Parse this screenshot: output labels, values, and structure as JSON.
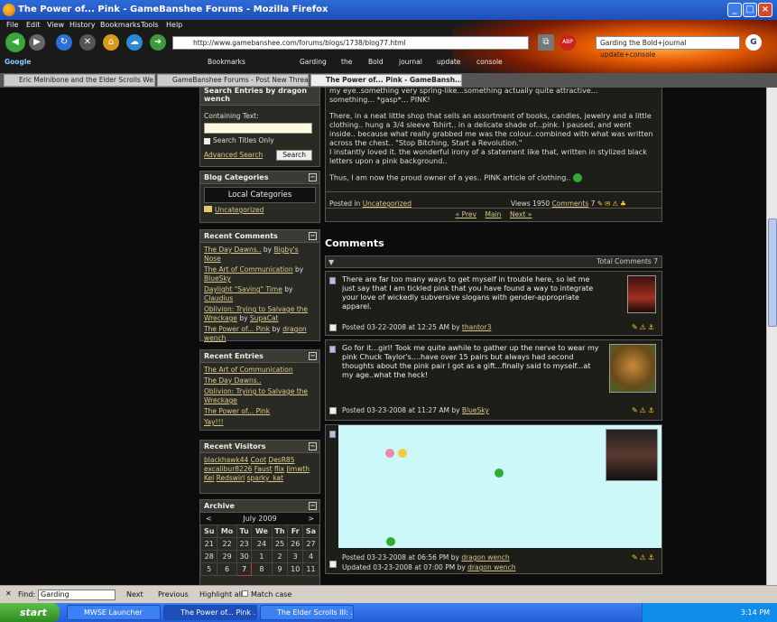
{
  "window": {
    "title": "The Power of... Pink - GameBanshee Forums - Mozilla Firefox"
  },
  "menu": [
    "File",
    "Edit",
    "View",
    "History",
    "Bookmarks",
    "Tools",
    "Help"
  ],
  "url": "http://www.gamebanshee.com/forums/blogs/1738/blog77.html",
  "search_value": "Garding the Bold+journal update+console",
  "bookmarks": [
    "Google",
    "Bookmarks",
    "Garding",
    "the",
    "Bold",
    "journal",
    "update",
    "console"
  ],
  "tabs": [
    "Eric Melnibone and the Elder Scrolls We...",
    "GameBanshee Forums - Post New Thread",
    "The Power of... Pink - GameBansh..."
  ],
  "sidebar": {
    "search": {
      "title": "Search Entries by dragon wench",
      "label": "Containing Text:",
      "titles_only": "Search Titles Only",
      "advanced": "Advanced Search",
      "button": "Search"
    },
    "categories": {
      "title": "Blog Categories",
      "local": "Local Categories",
      "item": "Uncategorized"
    },
    "recent_comments": {
      "title": "Recent Comments",
      "items": [
        {
          "t": "The Day Dawns..",
          "by": "by",
          "u": "Bigby's Nose"
        },
        {
          "t": "The Art of Communication",
          "by": "by",
          "u": "BlueSky"
        },
        {
          "t": "Daylight \"Saving\" Time",
          "by": "by",
          "u": "Claudius"
        },
        {
          "t": "Oblivion: Trying to Salvage the Wreckage",
          "by": "by",
          "u": "SupaCat"
        },
        {
          "t": "The Power of... Pink",
          "by": "by",
          "u": "dragon wench"
        }
      ]
    },
    "recent_entries": {
      "title": "Recent Entries",
      "items": [
        "The Art of Communication",
        "The Day Dawns..",
        "Oblivion: Trying to Salvage the Wreckage",
        "The Power of... Pink",
        "Yay!!!"
      ]
    },
    "visitors": {
      "title": "Recent Visitors",
      "names": [
        "blackhawk44",
        "Coot",
        "DesR85",
        "excalibur8226",
        "Faust",
        "flix",
        "Jimwth",
        "Kel",
        "Redswirl",
        "sparky_kat"
      ]
    },
    "archive": {
      "title": "Archive",
      "month": "July 2009",
      "prev": "<",
      "next": ">",
      "days": [
        "Su",
        "Mo",
        "Tu",
        "We",
        "Th",
        "Fr",
        "Sa"
      ],
      "weeks": [
        [
          "21",
          "22",
          "23",
          "24",
          "25",
          "26",
          "27"
        ],
        [
          "28",
          "29",
          "30",
          "1",
          "2",
          "3",
          "4"
        ],
        [
          "5",
          "6",
          "7",
          "8",
          "9",
          "10",
          "11"
        ]
      ]
    }
  },
  "post": {
    "line0": "my eye..something very spring-like...something actually quite attractive...",
    "line1": "something... *gasp*... PINK!",
    "para2": "There, in a neat little shop that sells an assortment of books, candles, jewelry and a little clothing.. hung a 3/4 sleeve Tshirt.. in a delicate shade of...pink. I paused, and went inside.. because what really grabbed me was the colour..combined with what was written across the chest.. \"Stop Bitching, Start a Revolution.\"",
    "para3": "I instantly loved it. the wonderful irony of a statement like that, written in stylized black letters upon a pink background..",
    "para4": "Thus, I am now the proud owner of a yes.. PINK article of clothing..",
    "posted_in": "Posted in",
    "category": "Uncategorized",
    "views": "Views 1950",
    "comments_link": "Comments",
    "comments_count": "7",
    "nav_prev": "« Prev",
    "nav_main": "Main",
    "nav_next": "Next »"
  },
  "comments": {
    "heading": "Comments",
    "total": "Total Comments 7",
    "items": [
      {
        "text": "There are far too many ways to get myself in trouble here, so let me just say that I am tickled pink that you have found a way to integrate your love of wickedly subversive slogans with gender-appropriate apparel.",
        "posted": "Posted 03-22-2008 at 12:25 AM by",
        "user": "thantor3"
      },
      {
        "text": "Go for it...girl! Took me quite awhile to gather up the nerve to wear my pink Chuck Taylor's....have over 15 pairs but always had second thoughts about the pink pair I got as a gift...finally said to myself...at my age..what the heck!",
        "posted": "Posted 03-23-2008 at 11:27 AM by",
        "user": "BlueSky"
      },
      {
        "posted": "Posted 03-23-2008 at 06:56 PM by",
        "user": "dragon wench",
        "updated": "Updated 03-23-2008 at 07:00 PM by",
        "updated_user": "dragon wench"
      }
    ]
  },
  "findbar": {
    "label": "Find:",
    "value": "Garding",
    "next": "Next",
    "previous": "Previous",
    "highlight": "Highlight all",
    "match": "Match case"
  },
  "taskbar": {
    "start": "start",
    "tasks": [
      "MWSE Launcher",
      "The Power of... Pink ...",
      "The Elder Scrolls III: ..."
    ],
    "clock": "3:14 PM"
  }
}
